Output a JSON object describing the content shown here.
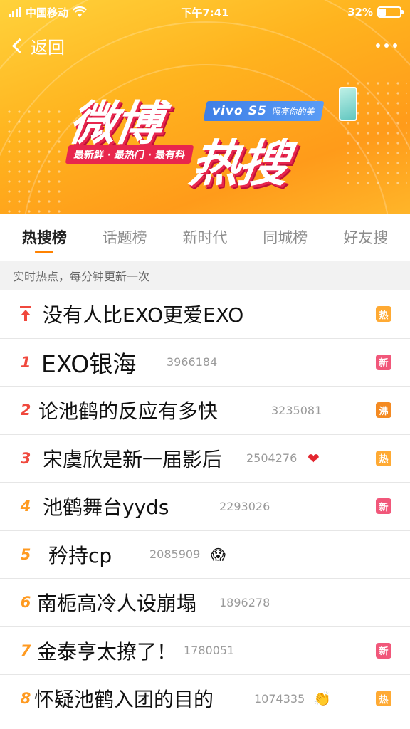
{
  "status_bar": {
    "carrier": "中国移动",
    "time": "下午7:41",
    "battery": "32%"
  },
  "nav": {
    "back_label": "返回"
  },
  "banner": {
    "logo_part1": "微博",
    "logo_part2": "热搜",
    "slogan": "最新鲜 · 最热门 · 最有料",
    "sponsor_brand": "vivo S5",
    "sponsor_tagline": "照亮你的美"
  },
  "tabs": [
    {
      "label": "热搜榜",
      "active": true
    },
    {
      "label": "话题榜"
    },
    {
      "label": "新时代"
    },
    {
      "label": "同城榜"
    },
    {
      "label": "好友搜"
    }
  ],
  "subheader": "实时热点，每分钟更新一次",
  "items": [
    {
      "rank": "",
      "pinned": true,
      "title": "没有人比EXO更爱EXO",
      "count": "",
      "badge": "热",
      "badge_color": "#ffaa33"
    },
    {
      "rank": "1",
      "title": "EXO银海",
      "count": "3966184",
      "badge": "新",
      "badge_color": "#f1577a"
    },
    {
      "rank": "2",
      "title": "论池鹤的反应有多快",
      "count": "3235081",
      "badge": "沸",
      "badge_color": "#f48a22"
    },
    {
      "rank": "3",
      "title": "宋虞欣是新一届影后",
      "count": "2504276",
      "emoji": "❤",
      "badge": "热",
      "badge_color": "#ffaa33"
    },
    {
      "rank": "4",
      "title": "池鹤舞台yyds",
      "count": "2293026",
      "badge": "新",
      "badge_color": "#f1577a"
    },
    {
      "rank": "5",
      "title": "矜持cp",
      "count": "2085909",
      "emoji": "😱"
    },
    {
      "rank": "6",
      "title": "南栀高冷人设崩塌",
      "count": "1896278"
    },
    {
      "rank": "7",
      "title": "金泰亨太撩了！",
      "count": "1780051",
      "badge": "新",
      "badge_color": "#f1577a"
    },
    {
      "rank": "8",
      "title": "怀疑池鹤入团的目的",
      "count": "1074335",
      "emoji": "👏",
      "badge": "热",
      "badge_color": "#ffaa33"
    }
  ]
}
